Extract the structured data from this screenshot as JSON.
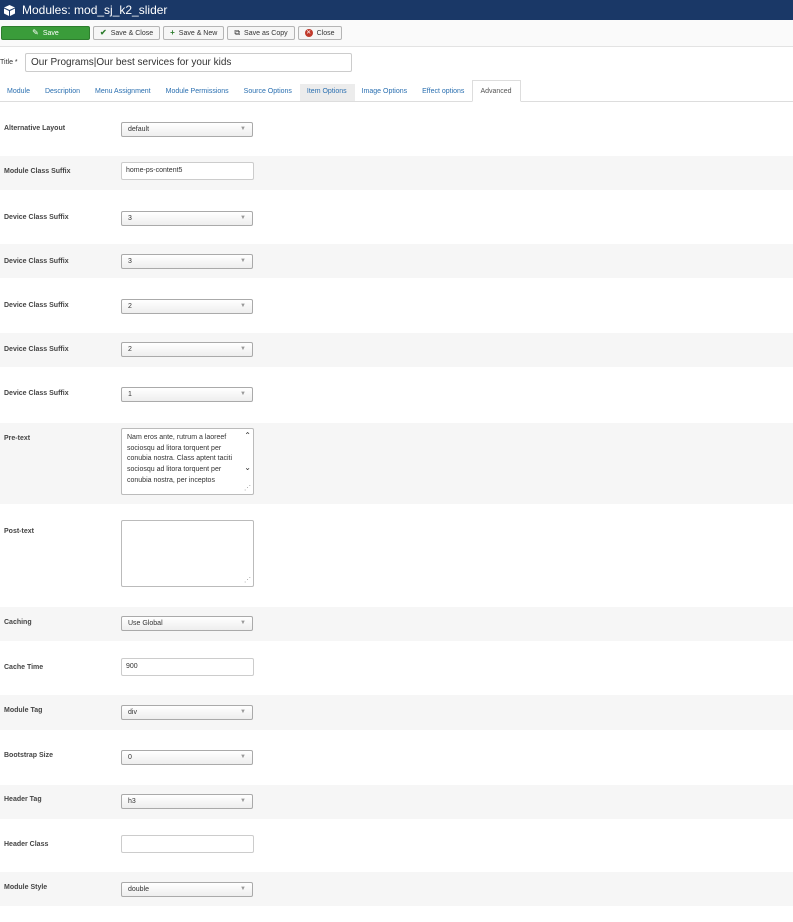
{
  "header": {
    "title": "Modules: mod_sj_k2_slider"
  },
  "toolbar": {
    "save": "Save",
    "save_close": "Save & Close",
    "save_new": "Save & New",
    "save_copy": "Save as Copy",
    "close": "Close"
  },
  "title_field": {
    "label": "Title *",
    "value": "Our Programs|Our best services for your kids"
  },
  "tabs": [
    {
      "label": "Module"
    },
    {
      "label": "Description"
    },
    {
      "label": "Menu Assignment"
    },
    {
      "label": "Module Permissions"
    },
    {
      "label": "Source Options"
    },
    {
      "label": "Item Options"
    },
    {
      "label": "Image Options"
    },
    {
      "label": "Effect options"
    },
    {
      "label": "Advanced"
    }
  ],
  "fields": {
    "alt_layout": {
      "label": "Alternative Layout",
      "value": "default"
    },
    "module_class_suffix": {
      "label": "Module Class Suffix",
      "value": "home-ps-content5"
    },
    "device_1": {
      "label": "Device Class Suffix",
      "value": "3"
    },
    "device_2": {
      "label": "Device Class Suffix",
      "value": "3"
    },
    "device_3": {
      "label": "Device Class Suffix",
      "value": "2"
    },
    "device_4": {
      "label": "Device Class Suffix",
      "value": "2"
    },
    "device_5": {
      "label": "Device Class Suffix",
      "value": "1"
    },
    "pre_text": {
      "label": "Pre-text",
      "value": "Nam eros ante, rutrum a laoreef sociosqu ad litora torquent per conubia nostra. Class aptent taciti sociosqu ad litora torquent per conubia nostra, per inceptos"
    },
    "post_text": {
      "label": "Post-text",
      "value": ""
    },
    "caching": {
      "label": "Caching",
      "value": "Use Global"
    },
    "cache_time": {
      "label": "Cache Time",
      "value": "900"
    },
    "module_tag": {
      "label": "Module Tag",
      "value": "div"
    },
    "bootstrap_size": {
      "label": "Bootstrap Size",
      "value": "0"
    },
    "header_tag": {
      "label": "Header Tag",
      "value": "h3"
    },
    "header_class": {
      "label": "Header Class",
      "value": ""
    },
    "module_style": {
      "label": "Module Style",
      "value": "double"
    }
  },
  "colors": {
    "topbar": "#1a3867",
    "save_button": "#3a9c3a",
    "tab_link": "#2a6fb0"
  }
}
